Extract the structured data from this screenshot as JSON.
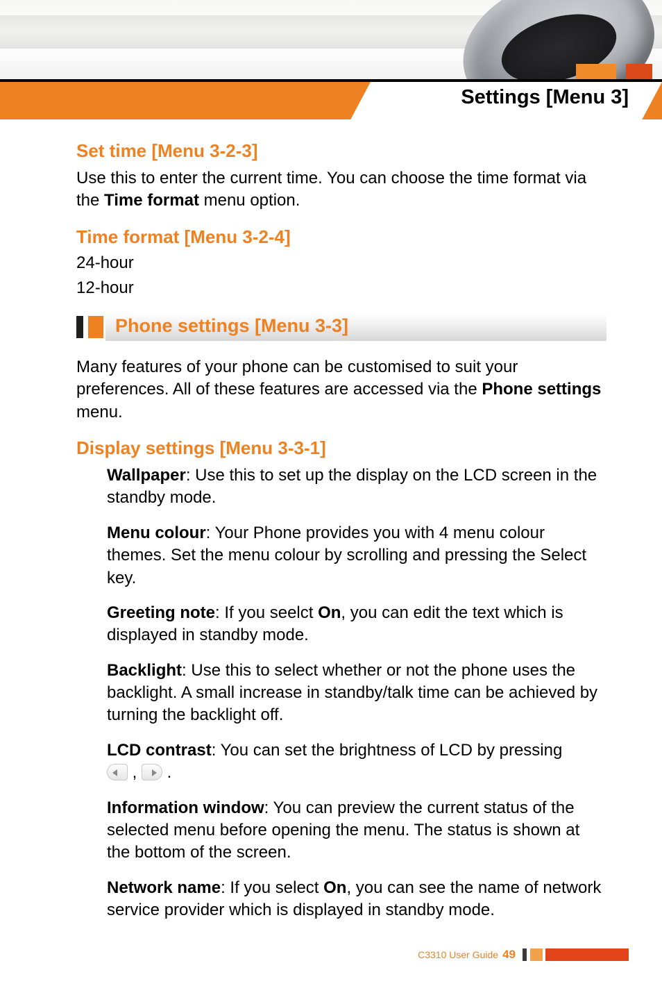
{
  "chapter_title": "Settings [Menu 3]",
  "sections": {
    "set_time": {
      "heading": "Set time [Menu 3-2-3]",
      "text_a": "Use this to enter the current time. You can choose the time format via the ",
      "text_bold": "Time format",
      "text_b": " menu option."
    },
    "time_format": {
      "heading": "Time format [Menu 3-2-4]",
      "opt1": "24-hour",
      "opt2": "12-hour"
    },
    "phone_settings": {
      "heading": "Phone settings [Menu 3-3]",
      "intro_a": "Many features of your phone can be customised to suit your preferences. All of these features are accessed via the ",
      "intro_bold": "Phone settings",
      "intro_b": " menu."
    },
    "display_settings": {
      "heading": "Display settings [Menu 3-3-1]",
      "items": {
        "wallpaper": {
          "label": "Wallpaper",
          "text": ": Use this to set up the display on the LCD screen in the standby mode."
        },
        "menu_colour": {
          "label": "Menu colour",
          "text": ": Your Phone provides you with 4 menu colour themes. Set the menu colour by scrolling and pressing the Select key."
        },
        "greeting_note": {
          "label": "Greeting note",
          "text_a": ": If you seelct ",
          "on": "On",
          "text_b": ",  you can edit the text which is displayed in standby mode."
        },
        "backlight": {
          "label": "Backlight",
          "text": ": Use this to select whether or not the phone uses the backlight. A small increase in standby/talk time can be achieved by turning the backlight off."
        },
        "lcd_contrast": {
          "label": "LCD contrast",
          "text": ": You can set the brightness of LCD by pressing "
        },
        "info_window": {
          "label": "Information window",
          "text": ": You can preview the current status of the selected menu before opening the menu. The status is shown at the bottom of the screen."
        },
        "network_name": {
          "label": "Network name",
          "text_a": ": If you select ",
          "on": "On",
          "text_b": ", you can see the name of network service provider which is displayed in standby mode."
        }
      }
    }
  },
  "footer": {
    "guide": "C3310 User Guide",
    "page": "49"
  }
}
